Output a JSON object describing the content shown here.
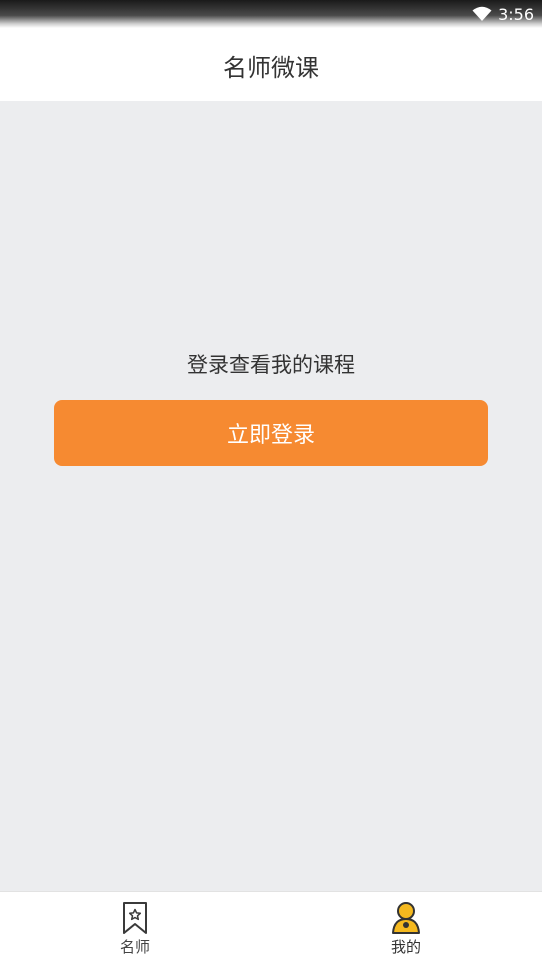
{
  "status_bar": {
    "time": "3:56",
    "wifi_icon": "wifi-icon"
  },
  "header": {
    "title": "名师微课"
  },
  "main": {
    "prompt": "登录查看我的课程",
    "login_button": "立即登录"
  },
  "tabbar": {
    "tabs": [
      {
        "label": "名师",
        "icon": "bookmark-star-icon",
        "active": false
      },
      {
        "label": "我的",
        "icon": "user-icon",
        "active": true
      }
    ]
  },
  "colors": {
    "accent": "#f68a31",
    "active_icon": "#f5b91f",
    "background": "#ecedef"
  }
}
